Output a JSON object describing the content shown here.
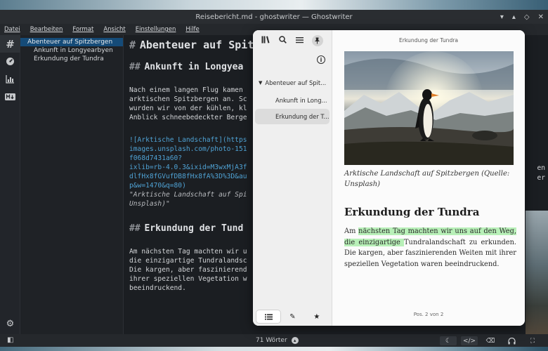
{
  "window": {
    "title": "Reisebericht.md - ghostwriter — Ghostwriter",
    "controls": {
      "minimize": "▾",
      "restore": "▴",
      "maximize": "◇",
      "close": "✕"
    }
  },
  "menu": [
    "Datei",
    "Bearbeiten",
    "Format",
    "Ansicht",
    "Einstellungen",
    "Hilfe"
  ],
  "sidebar_icons": [
    "hash-icon",
    "gauge-icon",
    "chart-icon",
    "markdown-icon",
    "gear-icon"
  ],
  "outline": {
    "items": [
      {
        "label": "Abenteuer auf Spitzbergen",
        "level": 1,
        "selected": true
      },
      {
        "label": "Ankunft in Longyearbyen",
        "level": 2,
        "selected": false
      },
      {
        "label": "Erkundung der Tundra",
        "level": 2,
        "selected": false
      }
    ]
  },
  "editor": {
    "h1_mark": "#",
    "h1_text": "Abenteuer auf Spit",
    "h2a_mark": "##",
    "h2a_text": "Ankunft in Longyea",
    "para1": [
      "Nach einem langen Flug kamen",
      "arktischen Spitzbergen an. Sc",
      "wurden wir von der kühlen, kl",
      "Anblick schneebedeckter Berge"
    ],
    "link": [
      "![Arktische Landschaft](https",
      "images.unsplash.com/photo-151",
      "f068d7431a60?",
      "ixlib=rb-4.0.3&ixid=M3wxMjA3f",
      "dlfHx8fGVufDB8fHx8fA%3D%3D&au",
      "p&w=1470&q=80)"
    ],
    "caption": [
      "\"Arktische Landschaft auf Spi",
      "Unsplash)\""
    ],
    "h2b_mark": "##",
    "h2b_text": "Erkundung der Tund",
    "para2": [
      "Am nächsten Tag machten wir u",
      "die einzigartige Tundralandsc",
      "Die kargen, aber faszinierend",
      "ihrer speziellen Vegetation w",
      "beeindruckend."
    ],
    "right_overflow": [
      "en",
      "er"
    ]
  },
  "status": {
    "word_count": "71 Wörter",
    "buttons": [
      "moon-icon",
      "code-icon",
      "backspace-icon",
      "headphones-icon",
      "fullscreen-icon"
    ]
  },
  "popup": {
    "toolbar": [
      "library-icon",
      "search-icon",
      "menu-icon",
      "pin-icon"
    ],
    "info_label": "i",
    "toc": [
      {
        "label": "Abenteuer auf Spit...",
        "expanded": true
      },
      {
        "label": "Ankunft in Long...",
        "selected": false
      },
      {
        "label": "Erkundung der T...",
        "selected": true
      }
    ],
    "bottom_tabs": [
      "list-icon",
      "pencil-icon",
      "star-icon"
    ],
    "header": "Erkundung der Tundra",
    "caption": "Arktische Landschaft auf Spitzbergen (Quelle: Unsplash)",
    "h2": "Erkundung der Tundra",
    "para_prefix": "Am ",
    "para_highlight": "nächsten Tag machten wir uns auf den Weg, die einzigartige ",
    "para_rest": "Tundralandschaft zu erkunden. Die kargen, aber faszinierenden Weiten mit ihrer speziellen Vegetation waren beeindruckend.",
    "footer": "Pos. 2 von 2"
  }
}
